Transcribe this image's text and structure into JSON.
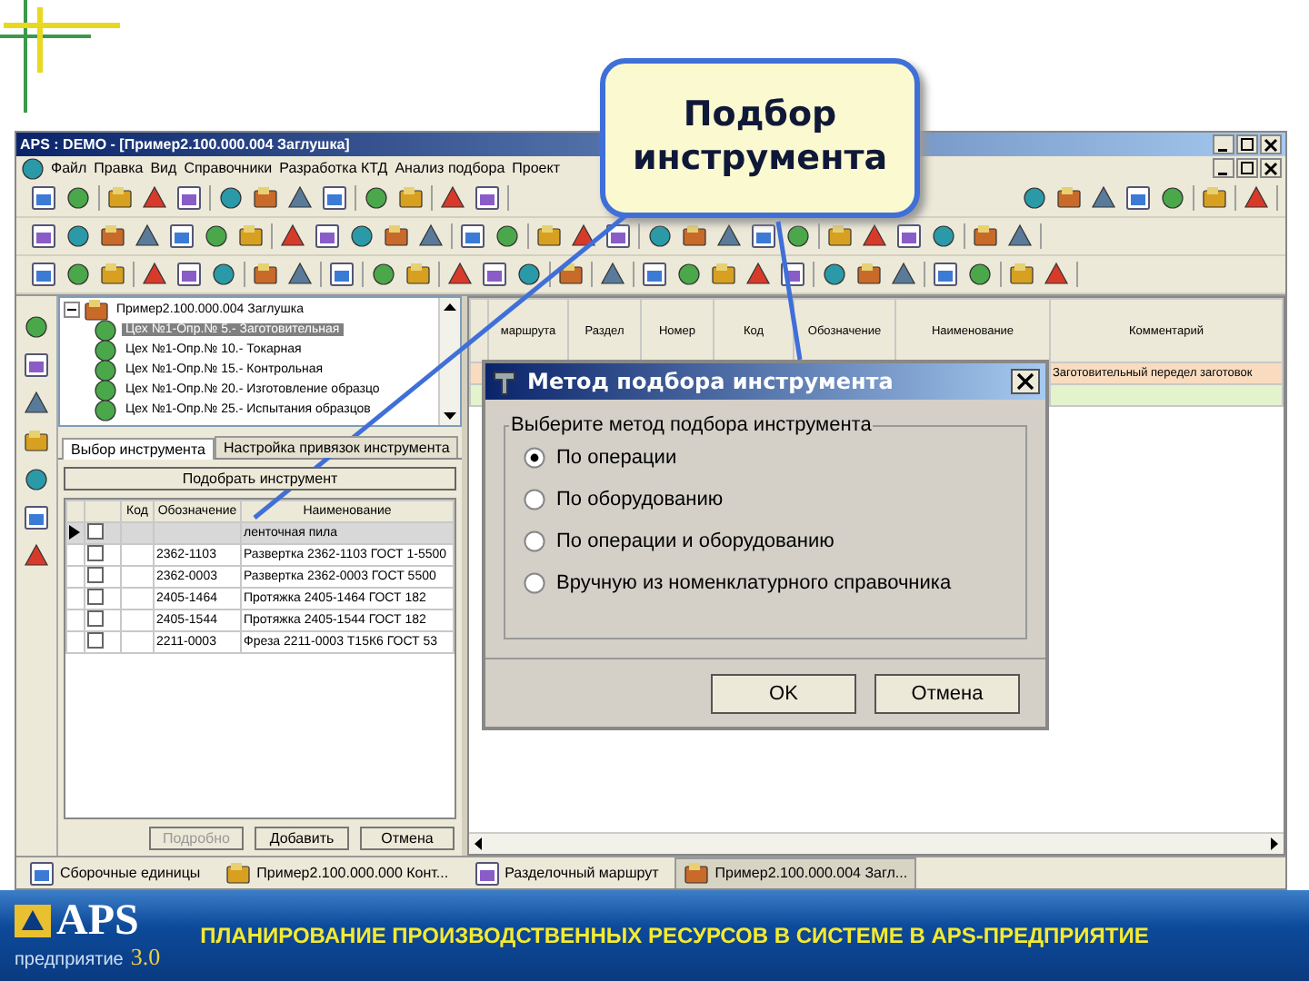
{
  "window": {
    "title": "APS : DEMO - [Пример2.100.000.004 Заглушка]"
  },
  "menu": [
    "Файл",
    "Правка",
    "Вид",
    "Справочники",
    "Разработка КТД",
    "Анализ подбора",
    "Проект"
  ],
  "tree": [
    {
      "label": "Пример2.100.000.004 Заглушка",
      "expanded": true,
      "selected": false,
      "children": [
        {
          "label": "Цех №1-Опр.№ 5.- Заготовительная",
          "selected": true
        },
        {
          "label": "Цех №1-Опр.№ 10.- Токарная",
          "selected": false
        },
        {
          "label": "Цех №1-Опр.№ 15.- Контрольная",
          "selected": false
        },
        {
          "label": "Цех №1-Опр.№ 20.- Изготовление образцо",
          "selected": false
        },
        {
          "label": "Цех №1-Опр.№ 25.- Испытания образцов",
          "selected": false
        }
      ]
    }
  ],
  "tabs": [
    {
      "label": "Выбор инструмента",
      "selected": true
    },
    {
      "label": "Настройка привязок инструмента",
      "selected": false
    }
  ],
  "pick_button": "Подобрать инструмент",
  "tool_table": {
    "columns": [
      "Код",
      "Обозначение",
      "Наименование"
    ],
    "rows": [
      {
        "selected": true,
        "checked": false,
        "name": "ленточная пила"
      },
      {
        "selected": false,
        "checked": false,
        "designation": "2362-1103",
        "name": "Развертка 2362-1103 ГОСТ 1-5500"
      },
      {
        "selected": false,
        "checked": false,
        "designation": "2362-0003",
        "name": "Развертка 2362-0003 ГОСТ 5500"
      },
      {
        "selected": false,
        "checked": false,
        "designation": "2405-1464",
        "name": "Протяжка 2405-1464 ГОСТ 182"
      },
      {
        "selected": false,
        "checked": false,
        "designation": "2405-1544",
        "name": "Протяжка 2405-1544 ГОСТ 182"
      },
      {
        "selected": false,
        "checked": false,
        "designation": "2211-0003",
        "name": "Фреза 2211-0003 Т15К6 ГОСТ 53"
      }
    ]
  },
  "bottom_buttons": [
    {
      "label": "Подробно",
      "disabled": true
    },
    {
      "label": "Добавить",
      "disabled": false
    },
    {
      "label": "Отмена",
      "disabled": false
    }
  ],
  "route_table": {
    "columns": [
      "маршрута",
      "Раздел",
      "Номер",
      "Код",
      "Обозначение",
      "Наименование",
      "Комментарий"
    ],
    "rows": [
      {
        "color": "#f9dcc0",
        "comment": "Заготовительный передел заготовок"
      },
      {
        "color": "#e3f3cc"
      }
    ]
  },
  "taskbar": [
    {
      "label": "Сборочные единицы",
      "selected": false
    },
    {
      "label": "Пример2.100.000.000 Конт...",
      "selected": false
    },
    {
      "label": "Разделочный маршрут",
      "selected": false
    },
    {
      "label": "Пример2.100.000.004 Загл...",
      "selected": true
    }
  ],
  "dialog": {
    "title": "Метод подбора инструмента",
    "group_label": "Выберите метод  подбора инструмента",
    "options": [
      {
        "label": "По операции",
        "selected": true
      },
      {
        "label": "По оборудованию",
        "selected": false
      },
      {
        "label": "По операции и оборудованию",
        "selected": false
      },
      {
        "label": "Вручную из номенклатурного справочника",
        "selected": false
      }
    ],
    "buttons": [
      "OK",
      "Отмена"
    ]
  },
  "callout": {
    "text": "Подбор инструмента"
  },
  "banner": {
    "logo": "APS",
    "edition": "предприятие",
    "version": "3.0",
    "title": "ПЛАНИРОВАНИЕ ПРОИЗВОДСТВЕННЫХ РЕСУРСОВ В СИСТЕМЕ В APS-ПРЕДПРИЯТИЕ"
  }
}
